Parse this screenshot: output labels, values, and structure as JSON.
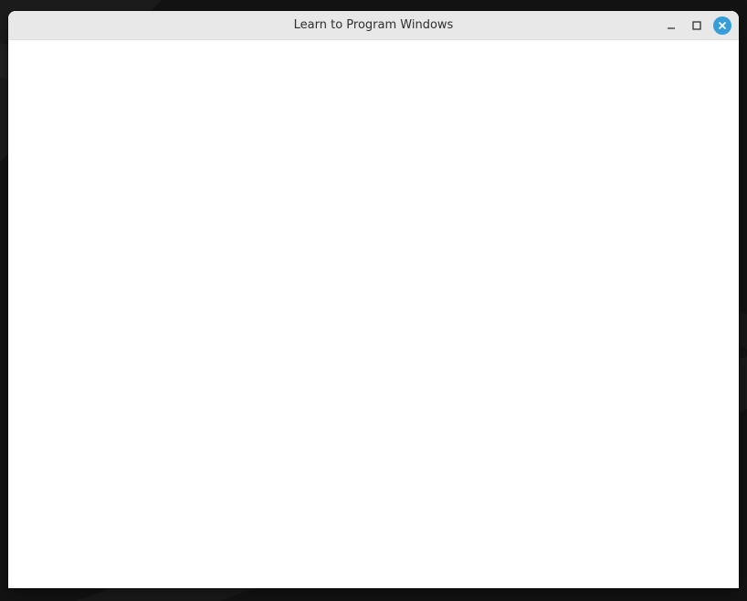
{
  "window": {
    "title": "Learn to Program Windows"
  },
  "titlebar": {
    "buttons": [
      {
        "label": "",
        "icon": "minimize-icon"
      },
      {
        "label": "",
        "icon": "maximize-icon"
      },
      {
        "label": "",
        "icon": "close-icon"
      }
    ]
  },
  "colors": {
    "titlebar_bg": "#e8e8e8",
    "close_button_bg": "#359ed8",
    "content_bg": "#ffffff",
    "desktop_bg": "#131313"
  }
}
